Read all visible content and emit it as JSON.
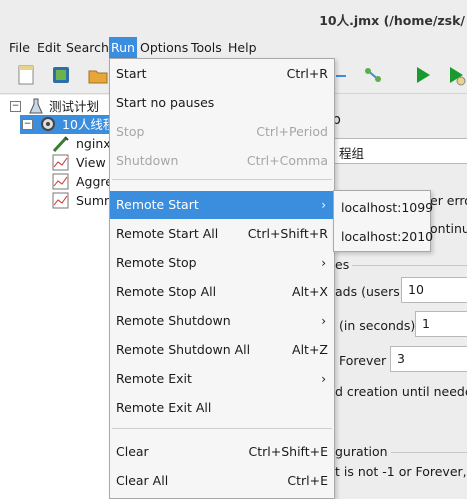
{
  "window": {
    "title": "10人.jmx (/home/zsk/"
  },
  "menubar": [
    {
      "label": "File"
    },
    {
      "label": "Edit"
    },
    {
      "label": "Search"
    },
    {
      "label": "Run"
    },
    {
      "label": "Options"
    },
    {
      "label": "Tools"
    },
    {
      "label": "Help"
    }
  ],
  "toolbar_icons": [
    "new-icon",
    "templates-icon",
    "open-icon",
    "remote-icon",
    "start-icon",
    "start-no-pauses-icon"
  ],
  "tree": {
    "items": [
      {
        "label": "测试计划",
        "icon": "flask-icon"
      },
      {
        "label": "10人线程",
        "icon": "gear-icon"
      },
      {
        "label": "nginx",
        "icon": "pipette-icon"
      },
      {
        "label": "View",
        "icon": "graph-icon"
      },
      {
        "label": "Aggre",
        "icon": "graph-icon"
      },
      {
        "label": "Summ",
        "icon": "graph-icon"
      }
    ]
  },
  "run_menu": {
    "items": [
      {
        "label": "Start",
        "accel": "Ctrl+R"
      },
      {
        "label": "Start no pauses",
        "accel": ""
      },
      {
        "label": "Stop",
        "accel": "Ctrl+Period"
      },
      {
        "label": "Shutdown",
        "accel": "Ctrl+Comma"
      },
      {
        "label": "Remote Start",
        "accel": ""
      },
      {
        "label": "Remote Start All",
        "accel": "Ctrl+Shift+R"
      },
      {
        "label": "Remote Stop",
        "accel": ""
      },
      {
        "label": "Remote Stop All",
        "accel": "Alt+X"
      },
      {
        "label": "Remote Shutdown",
        "accel": ""
      },
      {
        "label": "Remote Shutdown All",
        "accel": "Alt+Z"
      },
      {
        "label": "Remote Exit",
        "accel": ""
      },
      {
        "label": "Remote Exit All",
        "accel": ""
      },
      {
        "label": "Clear",
        "accel": "Ctrl+Shift+E"
      },
      {
        "label": "Clear All",
        "accel": "Ctrl+E"
      }
    ]
  },
  "remote_start_submenu": [
    "localhost:1099",
    "localhost:2010"
  ],
  "right_pane": {
    "partial_header": "p",
    "name_value": "程组",
    "error_text": "er erro",
    "continue_text": "ontinue",
    "properties_text": "es",
    "threads_label": "ads (users):",
    "threads_value": "10",
    "rampup_label": "(in seconds):",
    "rampup_value": "1",
    "loop_label": "Forever",
    "loop_value": "3",
    "delay_text": "d creation until needed",
    "scheduler_text": "guration",
    "duration_note": "t is not -1 or Forever, du"
  },
  "colors": {
    "accent": "#3b8ddd",
    "menu_bg": "#f6f6f6",
    "disabled": "#a6a6a6"
  }
}
